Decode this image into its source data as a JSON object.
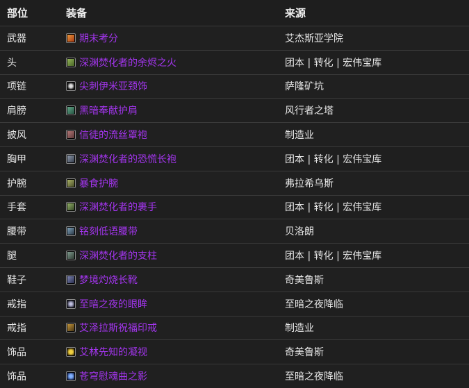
{
  "table": {
    "headers": {
      "slot": "部位",
      "item": "装备",
      "source": "来源"
    },
    "rows": [
      {
        "slot": "武器",
        "item": "期末考分",
        "icon": "weapon-icon",
        "source": "艾杰斯亚学院"
      },
      {
        "slot": "头",
        "item": "深渊焚化者的余烬之火",
        "icon": "helm-icon",
        "source": "团本 | 转化 | 宏伟宝库"
      },
      {
        "slot": "项链",
        "item": "尖刺伊米亚颈饰",
        "icon": "necklace-icon",
        "source": "萨隆矿坑"
      },
      {
        "slot": "肩膀",
        "item": "黑暗奉献护肩",
        "icon": "shoulder-icon",
        "source": "风行者之塔"
      },
      {
        "slot": "披风",
        "item": "信徒的流丝罩袍",
        "icon": "cloak-icon",
        "source": "制造业"
      },
      {
        "slot": "胸甲",
        "item": "深渊焚化者的恐慌长袍",
        "icon": "chest-icon",
        "source": "团本 | 转化 | 宏伟宝库"
      },
      {
        "slot": "护腕",
        "item": "暴食护腕",
        "icon": "bracer-icon",
        "source": "弗拉希乌斯"
      },
      {
        "slot": "手套",
        "item": "深渊焚化者的裹手",
        "icon": "gloves-icon",
        "source": "团本 | 转化 | 宏伟宝库"
      },
      {
        "slot": "腰带",
        "item": "铭刻低语腰带",
        "icon": "belt-icon",
        "source": "贝洛朗"
      },
      {
        "slot": "腿",
        "item": "深渊焚化者的支柱",
        "icon": "legs-icon",
        "source": "团本 | 转化 | 宏伟宝库"
      },
      {
        "slot": "鞋子",
        "item": "梦境灼烧长靴",
        "icon": "boots-icon",
        "source": "奇美鲁斯"
      },
      {
        "slot": "戒指",
        "item": "至暗之夜的眼眸",
        "icon": "ring-icon",
        "source": "至暗之夜降临"
      },
      {
        "slot": "戒指",
        "item": "艾泽拉斯祝福印戒",
        "icon": "ring-icon",
        "source": "制造业"
      },
      {
        "slot": "饰品",
        "item": "艾林先知的凝视",
        "icon": "trinket-icon",
        "source": "奇美鲁斯"
      },
      {
        "slot": "饰品",
        "item": "苍穹慰魂曲之影",
        "icon": "trinket-icon",
        "source": "至暗之夜降临"
      }
    ]
  },
  "colors": {
    "background": "#1c1c1c",
    "text": "#e6e6e6",
    "item_link": "#a335ee",
    "divider": "#3a3a3a"
  }
}
